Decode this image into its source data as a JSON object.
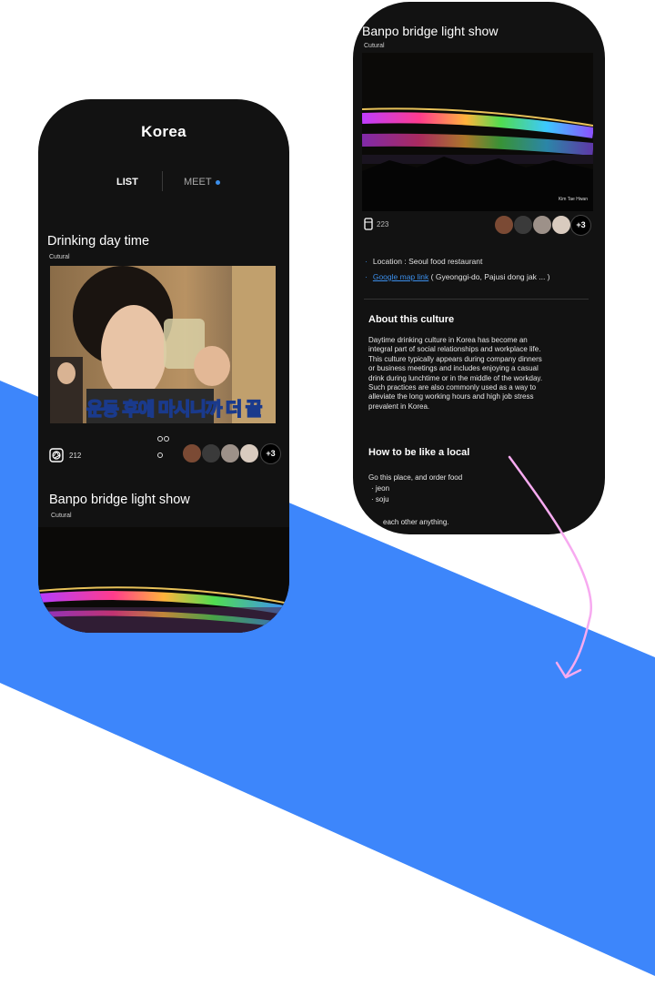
{
  "colors": {
    "blue_band": "#3d86fb",
    "phone_bg": "#121212",
    "accent": "#3b8eea",
    "arrow": "#f7aaf0"
  },
  "list_screen": {
    "title": "Korea",
    "tabs": {
      "list": "LIST",
      "meet": "MEET"
    },
    "cards": [
      {
        "title": "Drinking day time",
        "category": "Cutural",
        "caption_overlay": "운동 후에 마시니까 더 꿀",
        "count_icon": "shutter-icon",
        "count": "212",
        "extra_members": "+3"
      },
      {
        "title": "Banpo bridge light show",
        "category": "Cutural"
      }
    ]
  },
  "detail_screen": {
    "title": "Banpo bridge light show",
    "category": "Cutural",
    "watermark": "Kim Tae Hwan",
    "count_icon": "bookmark-icon",
    "count": "223",
    "extra_members": "+3",
    "location": "Location : Seoul food restaurant",
    "map_link": "Google map link",
    "map_address": "( Gyeonggi-do, Pajusi dong jak ... )",
    "about_heading": "About this culture",
    "about_lines": [
      "Daytime drinking culture in Korea has become an",
      "integral part of social relationships and workplace life.",
      "This culture typically appears during company dinners",
      "or business meetings and includes enjoying a casual",
      "drink during lunchtime or in the middle of the workday.",
      "Such practices are also commonly used as a way to",
      "alleviate the long working hours and high job stress",
      "prevalent in Korea."
    ],
    "howto_heading": "How to be like a local",
    "howto_intro": "Go this place, and order food",
    "howto_items": [
      "jeon",
      "soju"
    ],
    "howto_last": "each other anything."
  }
}
